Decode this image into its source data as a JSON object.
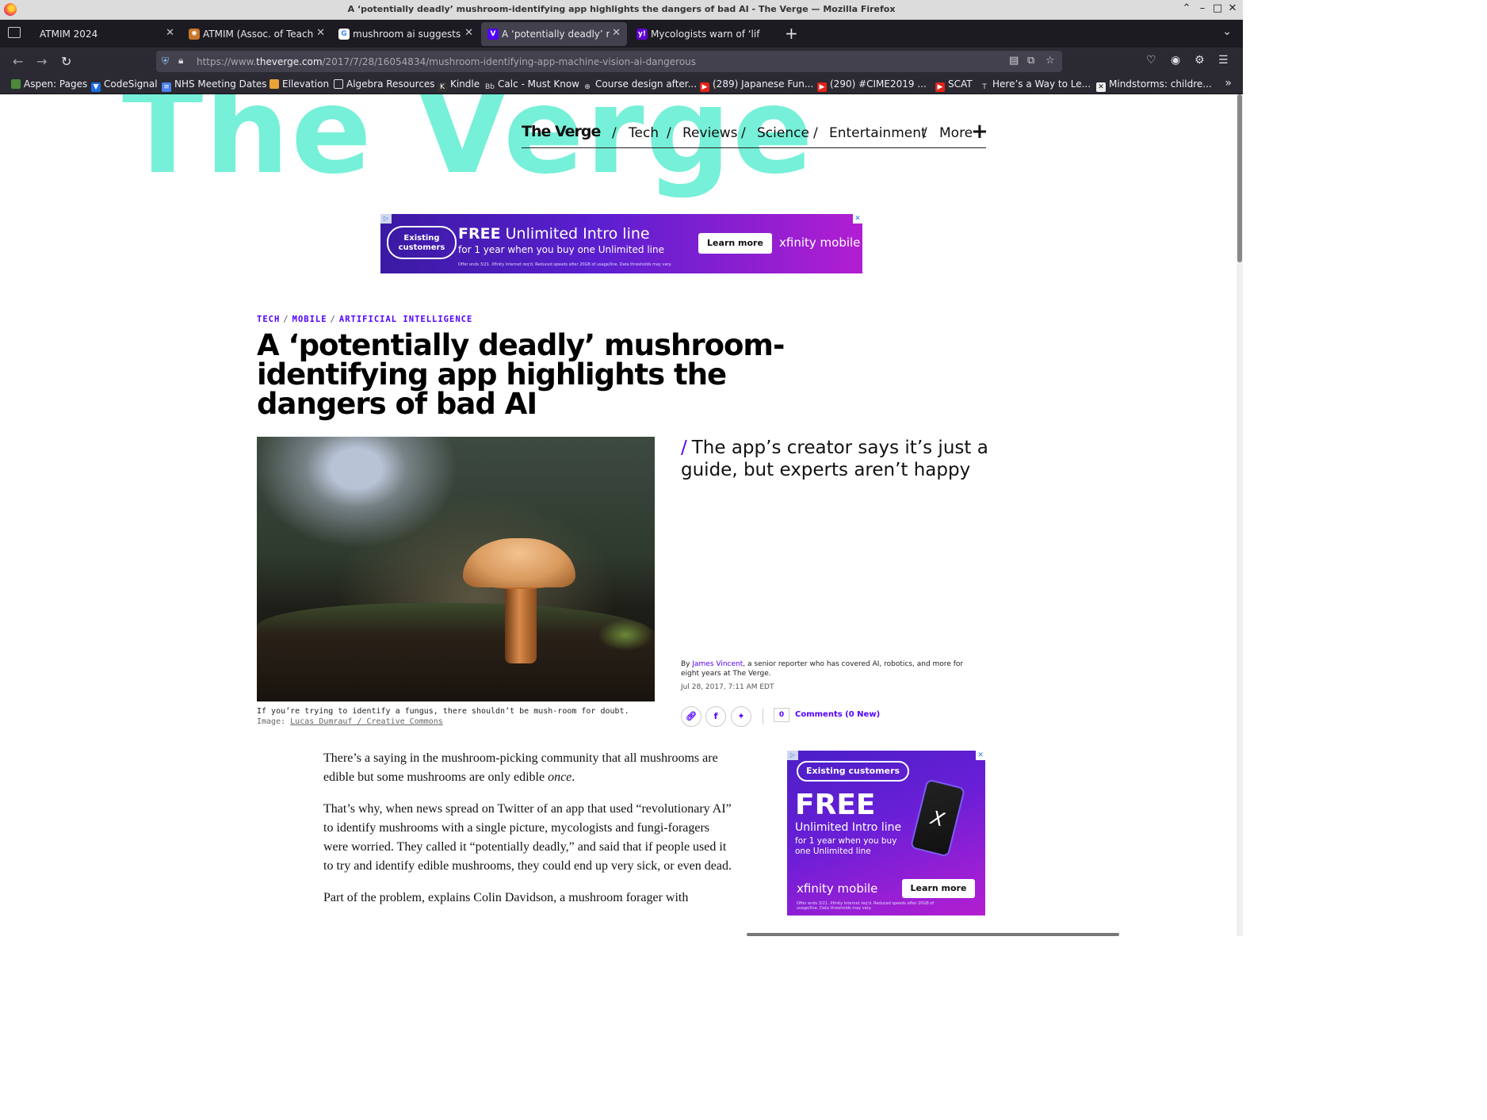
{
  "window": {
    "title": "A ‘potentially deadly’ mushroom-identifying app highlights the dangers of bad AI - The Verge — Mozilla Firefox"
  },
  "tabs": [
    {
      "label": "ATMIM 2024",
      "active": false
    },
    {
      "label": "ATMIM (Assoc. of Teachers",
      "active": false
    },
    {
      "label": "mushroom ai suggests p",
      "active": false
    },
    {
      "label": "A ‘potentially deadly’ mu",
      "active": true
    },
    {
      "label": "Mycologists warn of ‘life",
      "active": false
    }
  ],
  "urlbar": {
    "url_prefix": "https://www.",
    "url_domain": "theverge.com",
    "url_path": "/2017/7/28/16054834/mushroom-identifying-app-machine-vision-ai-dangerous"
  },
  "bookmarks": [
    "Aspen: Pages",
    "CodeSignal",
    "NHS Meeting Dates",
    "Ellevation",
    "Algebra Resources",
    "Kindle",
    "Calc - Must Know",
    "Course design after...",
    "(289) Japanese Fun...",
    "(290) #CIME2019 ...",
    "SCAT",
    "Here’s a Way to Le...",
    "Mindstorms: childre..."
  ],
  "site": {
    "bg_logo": "The Verge",
    "logo": "The Verge",
    "nav": [
      "Tech",
      "Reviews",
      "Science",
      "Entertainment",
      "More"
    ]
  },
  "ad_banner": {
    "pill": "Existing customers",
    "headline_bold": "FREE",
    "headline_rest": " Unlimited Intro line",
    "sub": "for 1 year when you buy one Unlimited line",
    "fine": "Offer ends 3/21. Xfinity Internet req'd. Reduced speeds after 20GB of usage/line. Data thresholds may vary.",
    "button": "Learn more",
    "brand": "xfinity mobile"
  },
  "article": {
    "breadcrumbs": [
      "TECH",
      "MOBILE",
      "ARTIFICIAL INTELLIGENCE"
    ],
    "headline": "A ‘potentially deadly’ mushroom-identifying app highlights the dangers of bad AI",
    "dek": "The app’s creator says it’s just a guide, but experts aren’t happy",
    "caption": "If you’re trying to identify a fungus, there shouldn’t be mush-room for doubt.",
    "credit_prefix": "Image: ",
    "credit_link": "Lucas Dumrauf / Creative Commons",
    "byline_prefix": "By ",
    "author": "James Vincent",
    "byline_rest": ", a senior reporter who has covered AI, robotics, and more for eight years at The Verge.",
    "date": "Jul 28, 2017, 7:11 AM EDT",
    "comments_count": "0",
    "comments_label": "Comments (0 New)",
    "paragraphs": [
      {
        "before": "There’s a saying in the mushroom-picking community that all mushrooms are edible but some mushrooms are only edible ",
        "em": "once",
        "after": "."
      },
      {
        "before": "That’s why, when news spread on Twitter of an app that used “revolutionary AI” to identify mushrooms with a single picture, mycologists and fungi-foragers were worried. They called it “potentially deadly,” and said that if people used it to try and identify edible mushrooms, they could end up very sick, or even dead.",
        "em": "",
        "after": ""
      },
      {
        "before": "Part of the problem, explains Colin Davidson, a mushroom forager with",
        "em": "",
        "after": ""
      }
    ]
  },
  "ad_box": {
    "pill": "Existing customers",
    "free": "FREE",
    "line1": "Unlimited Intro line",
    "line2": "for 1 year when you buy one Unlimited line",
    "brand": "xfinity mobile",
    "button": "Learn more",
    "fine": "Offer ends 3/21. Xfinity Internet req'd. Reduced speeds after 20GB of usage/line. Data thresholds may vary."
  },
  "colors": {
    "accent": "#5200ff",
    "logo_mint": "#6ff0d6",
    "ad_purple": "#6a1fd6"
  }
}
